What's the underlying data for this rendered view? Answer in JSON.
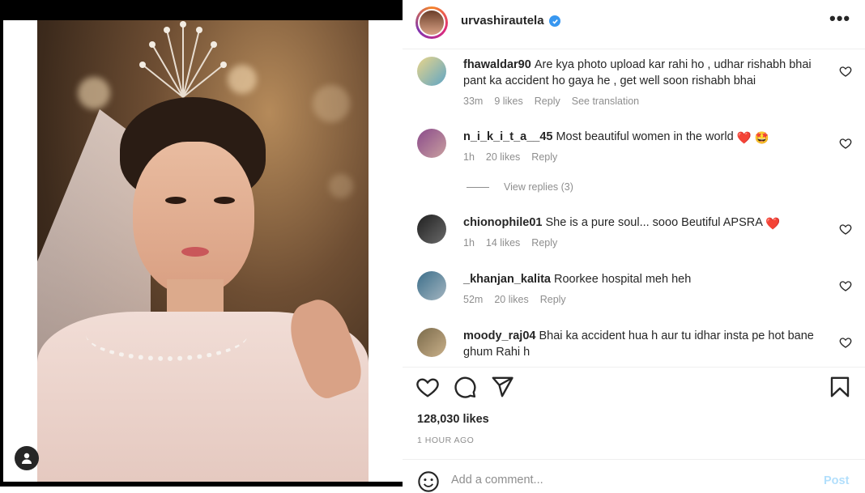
{
  "post": {
    "username": "urvashirautela",
    "more_icon": "more-horizontal-icon",
    "likes": "128,030 likes",
    "time": "1 HOUR AGO",
    "add_comment_placeholder": "Add a comment...",
    "post_label": "Post"
  },
  "comments": [
    {
      "user": "fhawaldar90",
      "text": "Are kya photo upload kar rahi ho , udhar rishabh bhai pant ka accident ho gaya he , get well soon rishabh bhai",
      "time": "33m",
      "likes": "9 likes",
      "reply": "Reply",
      "translate": "See translation"
    },
    {
      "user": "n_i_k_i_t_a__45",
      "text": "Most beautiful women in the world",
      "emoji": "❤️ 🤩",
      "time": "1h",
      "likes": "20 likes",
      "reply": "Reply",
      "view_replies": "View replies (3)"
    },
    {
      "user": "chionophile01",
      "text": "She is a pure soul... sooo Beutiful APSRA",
      "emoji": "❤️",
      "time": "1h",
      "likes": "14 likes",
      "reply": "Reply"
    },
    {
      "user": "_khanjan_kalita",
      "text": "Roorkee hospital meh heh",
      "time": "52m",
      "likes": "20 likes",
      "reply": "Reply"
    },
    {
      "user": "moody_raj04",
      "text": "Bhai ka accident hua h aur tu idhar insta pe hot bane ghum Rahi h"
    }
  ],
  "colors": {
    "verified": "#3897f0",
    "meta": "#8e8e8e",
    "post_disabled": "#b2dffc"
  }
}
